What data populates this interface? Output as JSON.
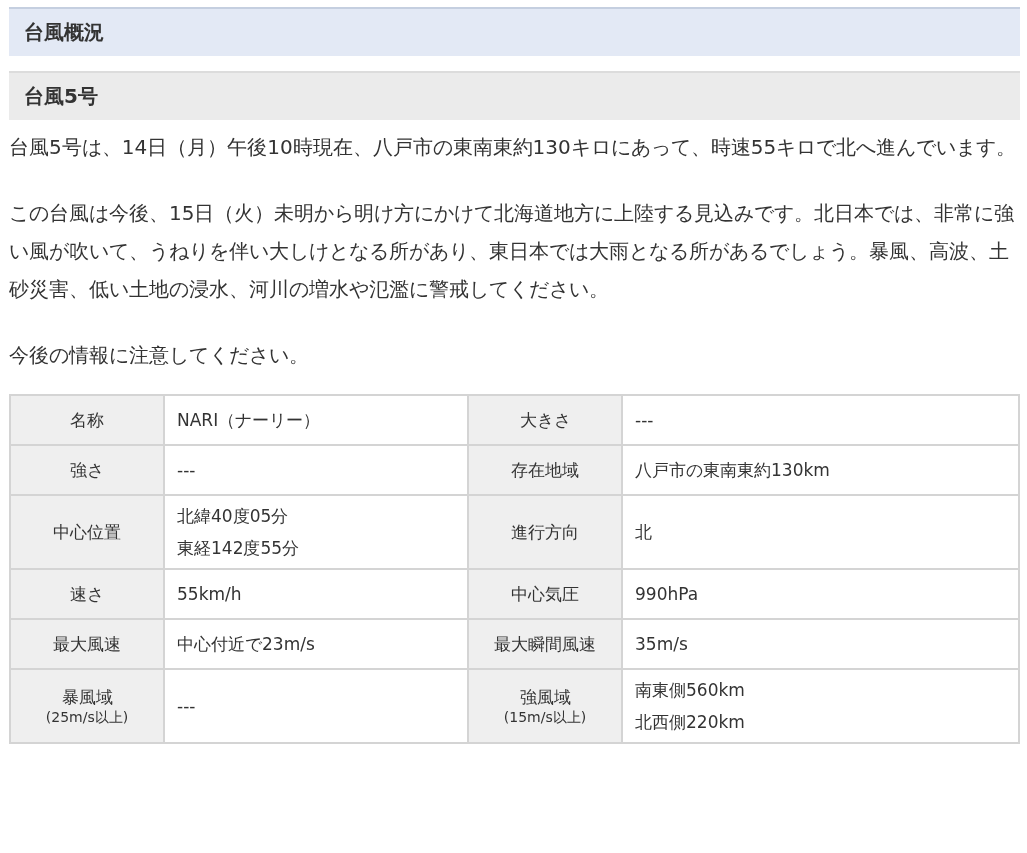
{
  "section_heading": "台風概況",
  "typhoon_heading": "台風5号",
  "paragraphs": [
    "台風5号は、14日（月）午後10時現在、八戸市の東南東約130キロにあって、時速55キロで北へ進んでいます。",
    "この台風は今後、15日（火）未明から明け方にかけて北海道地方に上陸する見込みです。北日本では、非常に強い風が吹いて、うねりを伴い大しけとなる所があり、東日本では大雨となる所があるでしょう。暴風、高波、土砂災害、低い土地の浸水、河川の増水や氾濫に警戒してください。",
    "今後の情報に注意してください。"
  ],
  "table": {
    "rows": [
      [
        {
          "label": "名称",
          "value": [
            "NARI（ナーリー）"
          ]
        },
        {
          "label": "大きさ",
          "value": [
            "---"
          ]
        }
      ],
      [
        {
          "label": "強さ",
          "value": [
            "---"
          ]
        },
        {
          "label": "存在地域",
          "value": [
            "八戸市の東南東約130km"
          ]
        }
      ],
      [
        {
          "label": "中心位置",
          "value": [
            "北緯40度05分",
            "東経142度55分"
          ]
        },
        {
          "label": "進行方向",
          "value": [
            "北"
          ]
        }
      ],
      [
        {
          "label": "速さ",
          "value": [
            "55km/h"
          ]
        },
        {
          "label": "中心気圧",
          "value": [
            "990hPa"
          ]
        }
      ],
      [
        {
          "label": "最大風速",
          "value": [
            "中心付近で23m/s"
          ]
        },
        {
          "label": "最大瞬間風速",
          "value": [
            "35m/s"
          ]
        }
      ],
      [
        {
          "label": "暴風域",
          "note": "(25m/s以上)",
          "value": [
            "---"
          ]
        },
        {
          "label": "強風域",
          "note": "(15m/s以上)",
          "value": [
            "南東側560km",
            "北西側220km"
          ]
        }
      ]
    ]
  }
}
